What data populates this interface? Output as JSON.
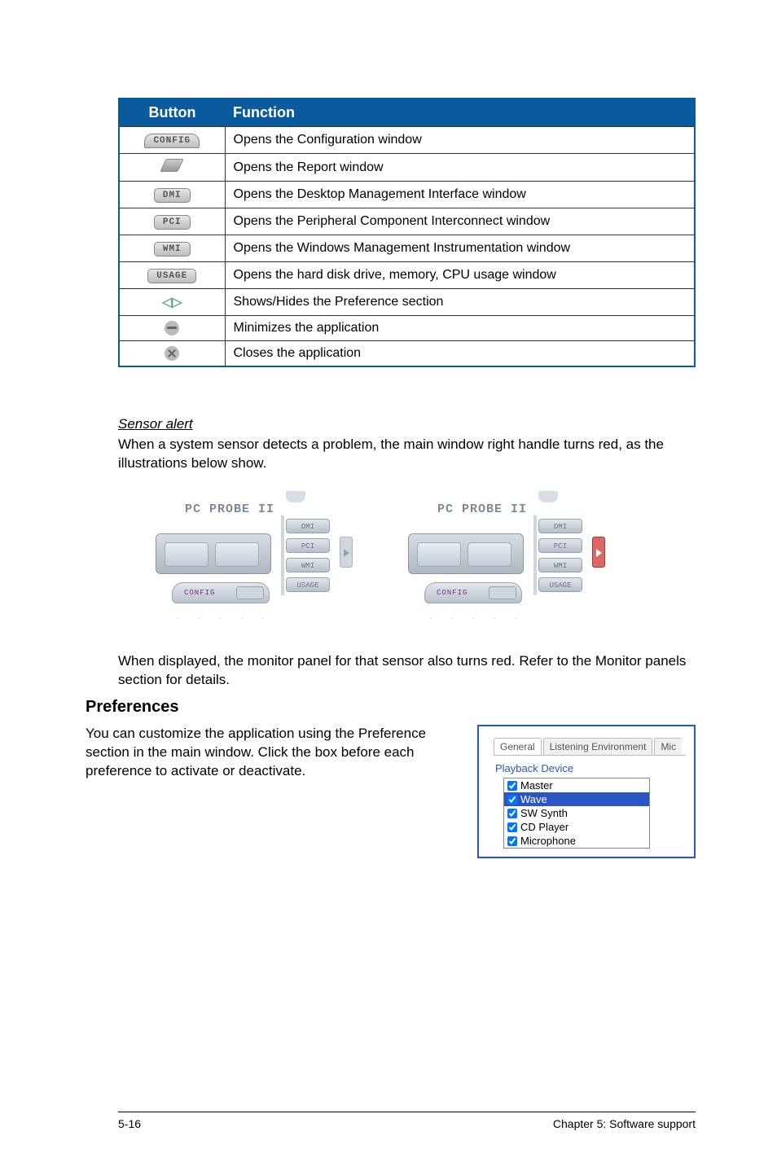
{
  "table": {
    "headers": {
      "button": "Button",
      "function": "Function"
    },
    "rows": [
      {
        "btn": "CONFIG",
        "func": "Opens the Configuration window"
      },
      {
        "btn": "report",
        "func": "Opens the Report window"
      },
      {
        "btn": "DMI",
        "func": "Opens the Desktop Management Interface window"
      },
      {
        "btn": "PCI",
        "func": "Opens the Peripheral Component Interconnect window"
      },
      {
        "btn": "WMI",
        "func": "Opens the Windows Management Instrumentation window"
      },
      {
        "btn": "USAGE",
        "func": "Opens the hard disk drive, memory, CPU usage window"
      },
      {
        "btn": "arrows",
        "func": "Shows/Hides the Preference section"
      },
      {
        "btn": "minus",
        "func": "Minimizes the application"
      },
      {
        "btn": "close",
        "func": "Closes the application"
      }
    ]
  },
  "sensor": {
    "heading": "Sensor alert",
    "para1": "When a system sensor detects a problem, the main window right handle turns red, as the illustrations below show.",
    "para2": "When displayed, the monitor panel for that sensor also turns red. Refer to the Monitor panels section for details."
  },
  "probe": {
    "title": "PC PROBE II",
    "chips": {
      "c1": "DMI",
      "c2": "PCI",
      "c3": "WMI",
      "c4": "USAGE"
    },
    "config": "CONFIG"
  },
  "prefs": {
    "heading": "Preferences",
    "para": "You can customize the application using the Preference section in the main window. Click the box before each preference to activate or deactivate.",
    "tabs": {
      "general": "General",
      "listening": "Listening Environment",
      "mic": "Mic"
    },
    "group": "Playback Device",
    "items": {
      "master": "Master",
      "wave": "Wave",
      "sw": "SW Synth",
      "cd": "CD Player",
      "micr": "Microphone"
    }
  },
  "footer": {
    "left": "5-16",
    "right": "Chapter 5: Software support"
  }
}
